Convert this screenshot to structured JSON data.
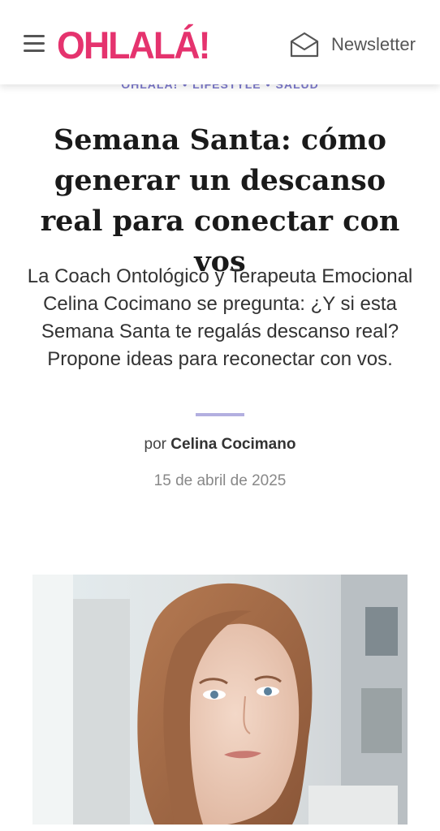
{
  "header": {
    "logo": "OHLALÁ!",
    "newsletter_label": "Newsletter",
    "menu_icon": "hamburger-menu-icon",
    "newsletter_icon": "envelope-icon",
    "logo_color": "#e5336e"
  },
  "breadcrumb": {
    "items": [
      "OHLALÁ!",
      "LIFESTYLE",
      "SALUD"
    ],
    "separator": "•"
  },
  "article": {
    "title": "Semana Santa: cómo generar un descanso real para conectar con vos",
    "subtitle": "La Coach Ontológico y Terapeuta Emocional Celina Cocimano se pregunta: ¿Y si esta Semana Santa te regalás descanso real? Propone ideas para reconectar con vos.",
    "byline_prefix": "por",
    "author": "Celina Cocimano",
    "date": "15 de abril de 2025"
  },
  "colors": {
    "accent": "#e5336e",
    "breadcrumb": "#7d7acb",
    "divider": "#b3afe0"
  }
}
